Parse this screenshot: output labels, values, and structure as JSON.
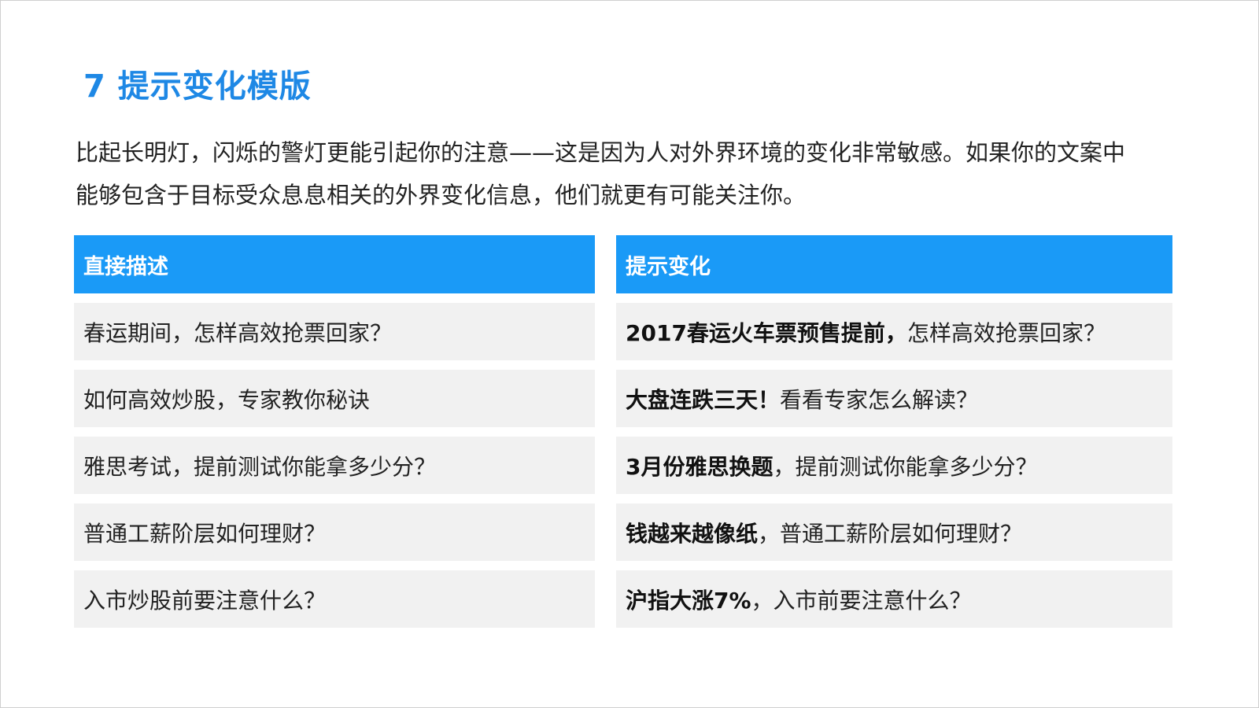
{
  "slide": {
    "title": "7 提示变化模版",
    "intro_lines": [
      "比起长明灯，闪烁的警灯更能引起你的注意——这是因为人对外界环境的变化非常敏感。如果你的文案中",
      "能够包含于目标受众息息相关的外界变化信息，他们就更有可能关注你。"
    ],
    "left_column": {
      "header": "直接描述",
      "rows": [
        "春运期间，怎样高效抢票回家？",
        "如何高效炒股，专家教你秘诀",
        "雅思考试，提前测试你能拿多少分？",
        "普通工薪阶层如何理财？",
        "入市炒股前要注意什么？"
      ]
    },
    "right_column": {
      "header": "提示变化",
      "rows": [
        {
          "bold": "2017春运火车票预售提前，",
          "normal": "怎样高效抢票回家？"
        },
        {
          "bold": "大盘连跌三天！",
          "normal": "看看专家怎么解读？"
        },
        {
          "bold": "3月份雅思换题",
          "normal": "，提前测试你能拿多少分？"
        },
        {
          "bold": "钱越来越像纸",
          "normal": "，普通工薪阶层如何理财？"
        },
        {
          "bold": "沪指大涨7%",
          "normal": "，入市前要注意什么？"
        }
      ]
    },
    "colors": {
      "title": "#1e88e5",
      "header_bg": "#1a9af7",
      "row_bg": "#f1f1f1"
    }
  }
}
